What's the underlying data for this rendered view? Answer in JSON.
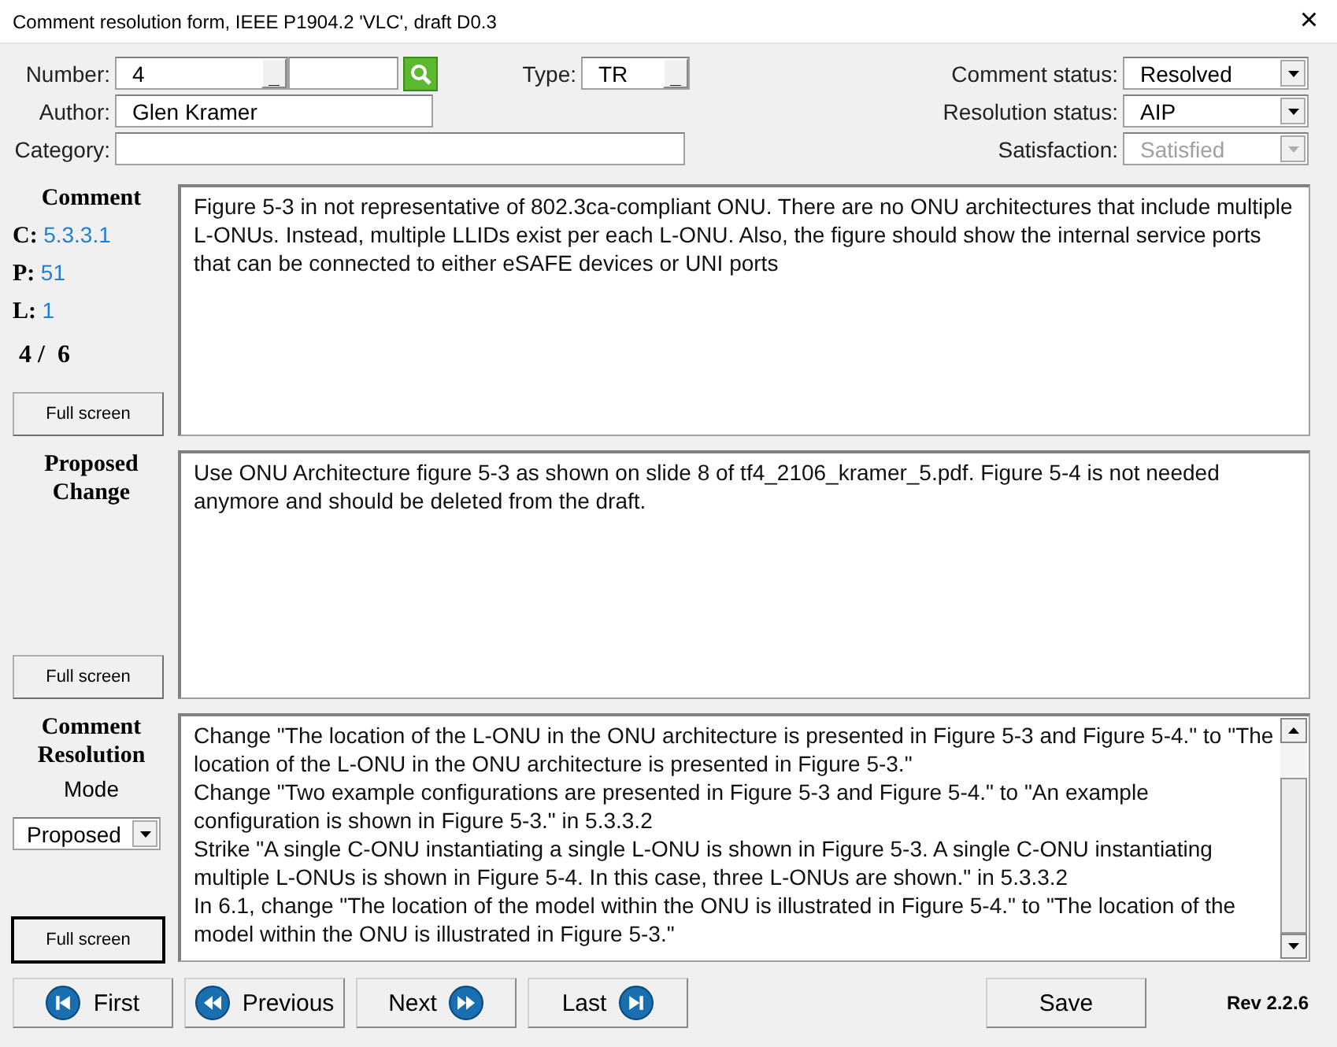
{
  "window": {
    "title": "Comment resolution form, IEEE P1904.2 'VLC', draft D0.3",
    "close": "×"
  },
  "header": {
    "number": {
      "label": "Number:",
      "value": "4",
      "button": "_"
    },
    "author": {
      "label": "Author:",
      "value": "Glen Kramer"
    },
    "category": {
      "label": "Category:"
    },
    "type": {
      "label": "Type:",
      "value": "TR",
      "button": "_"
    },
    "statuses": [
      {
        "label": "Comment status:",
        "value": "Resolved",
        "disabled": false
      },
      {
        "label": "Resolution status:",
        "value": "AIP",
        "disabled": false
      },
      {
        "label": "Satisfaction:",
        "value": "Satisfied",
        "disabled": true
      }
    ]
  },
  "sections": [
    {
      "kind": "comment",
      "heading": "Comment",
      "refs": [
        {
          "label": "C:",
          "value": "5.3.3.1"
        },
        {
          "label": "P:",
          "value": "51"
        },
        {
          "label": "L:",
          "value": "1"
        }
      ],
      "counter": "4 /  6",
      "button": {
        "label": "Full screen",
        "focused": false
      },
      "paragraphs": [
        "Figure 5-3 in not representative of 802.3ca-compliant ONU. There are no ONU architectures that include multiple L-ONUs. Instead, multiple LLIDs exist per each L-ONU. Also, the figure should show the internal service ports that can be connected to either eSAFE devices or UNI ports"
      ]
    },
    {
      "kind": "proposed",
      "heading": "Proposed Change",
      "button": {
        "label": "Full screen",
        "focused": false
      },
      "paragraphs": [
        "Use ONU Architecture figure 5-3 as shown on slide 8 of tf4_2106_kramer_5.pdf. Figure 5-4 is not needed anymore and should be deleted from the draft."
      ]
    },
    {
      "kind": "resolution",
      "heading": "Comment Resolution",
      "mode_label": "Mode",
      "mode": "Proposed",
      "button": {
        "label": "Full screen",
        "focused": true
      },
      "paragraphs": [
        "Change \"The location of the L-ONU in the ONU architecture is presented in Figure 5-3 and Figure 5-4.\" to \"The location of the L-ONU in the ONU architecture is presented in Figure 5-3.\"",
        "Change \"Two example configurations are presented in Figure 5-3 and Figure 5-4.\" to \"An example configuration is shown in Figure 5-3.\" in 5.3.3.2",
        "Strike \"A single C-ONU instantiating a single L-ONU is shown in Figure 5-3. A single C-ONU instantiating multiple L-ONUs is shown in Figure 5-4. In this case, three L-ONUs are shown.\" in 5.3.3.2",
        "In 6.1, change \"The location of the model within the ONU is illustrated in Figure 5-4.\" to \"The location of the model within the ONU is illustrated in Figure 5-3.\""
      ]
    }
  ],
  "nav": [
    {
      "kind": "first",
      "label": "First"
    },
    {
      "kind": "previous",
      "label": "Previous"
    },
    {
      "kind": "next",
      "label": "Next"
    },
    {
      "kind": "last",
      "label": "Last"
    }
  ],
  "save": "Save",
  "revision": "Rev 2.2.6"
}
